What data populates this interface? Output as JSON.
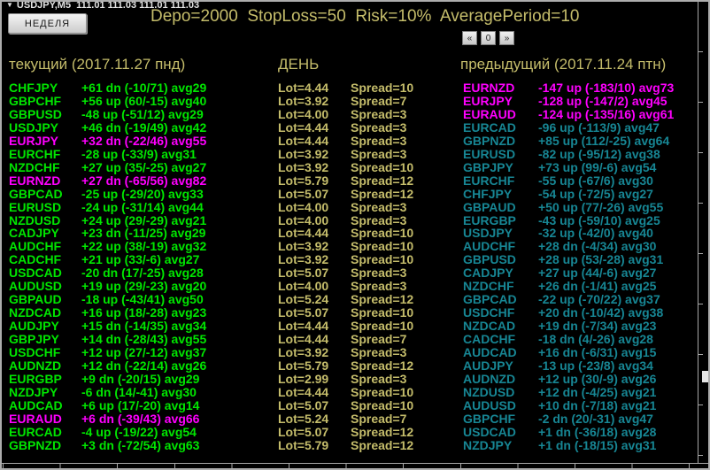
{
  "window": {
    "chart_title": "USDJPY,M5  111.01 111.03 111.01 111.03",
    "dropdown_icon": "▼",
    "week_button": "НЕДЕЛЯ",
    "params": "Depo=2000  StopLoss=50  Risk=10%  AveragePeriod=10",
    "nav": {
      "prev": "«",
      "zero": "0",
      "next": "»"
    }
  },
  "columns": {
    "current": {
      "header": "текущий (2017.11.27 пнд)"
    },
    "day": {
      "header": "ДЕНЬ"
    },
    "previous": {
      "header": "предыдущий (2017.11.24 птн)"
    }
  },
  "colors": {
    "green": "#00e600",
    "magenta": "#ff00ff",
    "teal": "#178694",
    "khaki": "#c5bd6b"
  },
  "rows": [
    {
      "cur": {
        "pair": "CHFJPY",
        "value": "+61 dn (-10/71) avg29",
        "color": "green"
      },
      "day": {
        "lot": "Lot=4.44",
        "spread": "Spread=10"
      },
      "prev": {
        "pair": "EURNZD",
        "value": "-147 up (-183/10) avg73",
        "color": "magenta"
      }
    },
    {
      "cur": {
        "pair": "GBPCHF",
        "value": "+56 up (60/-15) avg40",
        "color": "green"
      },
      "day": {
        "lot": "Lot=3.92",
        "spread": "Spread=7"
      },
      "prev": {
        "pair": "EURJPY",
        "value": "-128 up (-147/2) avg45",
        "color": "magenta"
      }
    },
    {
      "cur": {
        "pair": "GBPUSD",
        "value": "-48 up (-51/12) avg29",
        "color": "green"
      },
      "day": {
        "lot": "Lot=4.00",
        "spread": "Spread=3"
      },
      "prev": {
        "pair": "EURAUD",
        "value": "-124 up (-135/16) avg61",
        "color": "magenta"
      }
    },
    {
      "cur": {
        "pair": "USDJPY",
        "value": "+46 dn (-19/49) avg42",
        "color": "green"
      },
      "day": {
        "lot": "Lot=4.44",
        "spread": "Spread=3"
      },
      "prev": {
        "pair": "EURCAD",
        "value": "-96 up (-113/9) avg47",
        "color": "teal"
      }
    },
    {
      "cur": {
        "pair": "EURJPY",
        "value": "+32 dn (-22/46) avg55",
        "color": "magenta"
      },
      "day": {
        "lot": "Lot=4.44",
        "spread": "Spread=3"
      },
      "prev": {
        "pair": "GBPNZD",
        "value": "+85 up (112/-25) avg64",
        "color": "teal"
      }
    },
    {
      "cur": {
        "pair": "EURCHF",
        "value": "-28 up (-33/9) avg31",
        "color": "green"
      },
      "day": {
        "lot": "Lot=3.92",
        "spread": "Spread=3"
      },
      "prev": {
        "pair": "EURUSD",
        "value": "-82 up (-95/12) avg38",
        "color": "teal"
      }
    },
    {
      "cur": {
        "pair": "NZDCHF",
        "value": "+27 up (35/-25) avg27",
        "color": "green"
      },
      "day": {
        "lot": "Lot=3.92",
        "spread": "Spread=10"
      },
      "prev": {
        "pair": "GBPJPY",
        "value": "+73 up (99/-6) avg54",
        "color": "teal"
      }
    },
    {
      "cur": {
        "pair": "EURNZD",
        "value": "+27 dn (-65/56) avg82",
        "color": "magenta"
      },
      "day": {
        "lot": "Lot=5.79",
        "spread": "Spread=12"
      },
      "prev": {
        "pair": "EURCHF",
        "value": "-55 up (-67/6) avg30",
        "color": "teal"
      }
    },
    {
      "cur": {
        "pair": "GBPCAD",
        "value": "-25 up (-29/20) avg33",
        "color": "green"
      },
      "day": {
        "lot": "Lot=5.07",
        "spread": "Spread=12"
      },
      "prev": {
        "pair": "CHFJPY",
        "value": "-54 up (-72/5) avg27",
        "color": "teal"
      }
    },
    {
      "cur": {
        "pair": "EURUSD",
        "value": "-24 up (-31/14) avg44",
        "color": "green"
      },
      "day": {
        "lot": "Lot=4.00",
        "spread": "Spread=3"
      },
      "prev": {
        "pair": "GBPAUD",
        "value": "+50 up (77/-26) avg55",
        "color": "teal"
      }
    },
    {
      "cur": {
        "pair": "NZDUSD",
        "value": "+24 up (29/-29) avg21",
        "color": "green"
      },
      "day": {
        "lot": "Lot=4.00",
        "spread": "Spread=3"
      },
      "prev": {
        "pair": "EURGBP",
        "value": "-43 up (-59/10) avg25",
        "color": "teal"
      }
    },
    {
      "cur": {
        "pair": "CADJPY",
        "value": "+23 dn (-11/25) avg29",
        "color": "green"
      },
      "day": {
        "lot": "Lot=4.44",
        "spread": "Spread=10"
      },
      "prev": {
        "pair": "USDJPY",
        "value": "-32 up (-42/0) avg40",
        "color": "teal"
      }
    },
    {
      "cur": {
        "pair": "AUDCHF",
        "value": "+22 up (38/-19) avg32",
        "color": "green"
      },
      "day": {
        "lot": "Lot=3.92",
        "spread": "Spread=10"
      },
      "prev": {
        "pair": "AUDCHF",
        "value": "+28 dn (-4/34) avg30",
        "color": "teal"
      }
    },
    {
      "cur": {
        "pair": "CADCHF",
        "value": "+21 up (33/-6) avg27",
        "color": "green"
      },
      "day": {
        "lot": "Lot=3.92",
        "spread": "Spread=10"
      },
      "prev": {
        "pair": "GBPUSD",
        "value": "+28 up (53/-28) avg31",
        "color": "teal"
      }
    },
    {
      "cur": {
        "pair": "USDCAD",
        "value": "-20 dn (17/-25) avg28",
        "color": "green"
      },
      "day": {
        "lot": "Lot=5.07",
        "spread": "Spread=3"
      },
      "prev": {
        "pair": "CADJPY",
        "value": "+27 up (44/-6) avg27",
        "color": "teal"
      }
    },
    {
      "cur": {
        "pair": "AUDUSD",
        "value": "+19 up (29/-23) avg20",
        "color": "green"
      },
      "day": {
        "lot": "Lot=4.00",
        "spread": "Spread=3"
      },
      "prev": {
        "pair": "NZDCHF",
        "value": "+26 dn (-1/41) avg25",
        "color": "teal"
      }
    },
    {
      "cur": {
        "pair": "GBPAUD",
        "value": "-18 up (-43/41) avg50",
        "color": "green"
      },
      "day": {
        "lot": "Lot=5.24",
        "spread": "Spread=12"
      },
      "prev": {
        "pair": "GBPCAD",
        "value": "-22 up (-70/22) avg37",
        "color": "teal"
      }
    },
    {
      "cur": {
        "pair": "NZDCAD",
        "value": "+16 up (18/-28) avg23",
        "color": "green"
      },
      "day": {
        "lot": "Lot=5.07",
        "spread": "Spread=10"
      },
      "prev": {
        "pair": "USDCHF",
        "value": "+20 dn (-10/42) avg38",
        "color": "teal"
      }
    },
    {
      "cur": {
        "pair": "AUDJPY",
        "value": "+15 dn (-14/35) avg34",
        "color": "green"
      },
      "day": {
        "lot": "Lot=4.44",
        "spread": "Spread=10"
      },
      "prev": {
        "pair": "NZDCAD",
        "value": "+19 dn (-7/34) avg23",
        "color": "teal"
      }
    },
    {
      "cur": {
        "pair": "GBPJPY",
        "value": "+14 dn (-28/43) avg55",
        "color": "green"
      },
      "day": {
        "lot": "Lot=4.44",
        "spread": "Spread=7"
      },
      "prev": {
        "pair": "CADCHF",
        "value": "-18 dn (4/-26) avg28",
        "color": "teal"
      }
    },
    {
      "cur": {
        "pair": "USDCHF",
        "value": "+12 up (27/-12) avg37",
        "color": "green"
      },
      "day": {
        "lot": "Lot=3.92",
        "spread": "Spread=3"
      },
      "prev": {
        "pair": "AUDCAD",
        "value": "+16 dn (-6/31) avg15",
        "color": "teal"
      }
    },
    {
      "cur": {
        "pair": "AUDNZD",
        "value": "+12 dn (-22/14) avg26",
        "color": "green"
      },
      "day": {
        "lot": "Lot=5.79",
        "spread": "Spread=12"
      },
      "prev": {
        "pair": "AUDJPY",
        "value": "-13 up (-23/8) avg34",
        "color": "teal"
      }
    },
    {
      "cur": {
        "pair": "EURGBP",
        "value": "+9 dn (-20/15) avg29",
        "color": "green"
      },
      "day": {
        "lot": "Lot=2.99",
        "spread": "Spread=3"
      },
      "prev": {
        "pair": "AUDNZD",
        "value": "+12 up (30/-9) avg26",
        "color": "teal"
      }
    },
    {
      "cur": {
        "pair": "NZDJPY",
        "value": "-6 dn (14/-41) avg30",
        "color": "green"
      },
      "day": {
        "lot": "Lot=4.44",
        "spread": "Spread=10"
      },
      "prev": {
        "pair": "NZDUSD",
        "value": "+12 dn (-4/25) avg21",
        "color": "teal"
      }
    },
    {
      "cur": {
        "pair": "AUDCAD",
        "value": "+6 up (17/-20) avg14",
        "color": "green"
      },
      "day": {
        "lot": "Lot=5.07",
        "spread": "Spread=10"
      },
      "prev": {
        "pair": "AUDUSD",
        "value": "+10 dn (-7/18) avg21",
        "color": "teal"
      }
    },
    {
      "cur": {
        "pair": "EURAUD",
        "value": "+6 dn (-39/43) avg66",
        "color": "magenta"
      },
      "day": {
        "lot": "Lot=5.24",
        "spread": "Spread=7"
      },
      "prev": {
        "pair": "GBPCHF",
        "value": "-2 dn (20/-31) avg47",
        "color": "teal"
      }
    },
    {
      "cur": {
        "pair": "EURCAD",
        "value": "-4 up (-19/22) avg54",
        "color": "green"
      },
      "day": {
        "lot": "Lot=5.07",
        "spread": "Spread=12"
      },
      "prev": {
        "pair": "USDCAD",
        "value": "+1 dn (-36/18) avg28",
        "color": "teal"
      }
    },
    {
      "cur": {
        "pair": "GBPNZD",
        "value": "+3 dn (-72/54) avg63",
        "color": "green"
      },
      "day": {
        "lot": "Lot=5.79",
        "spread": "Spread=12"
      },
      "prev": {
        "pair": "NZDJPY",
        "value": "+1 dn (-18/15) avg31",
        "color": "teal"
      }
    }
  ]
}
